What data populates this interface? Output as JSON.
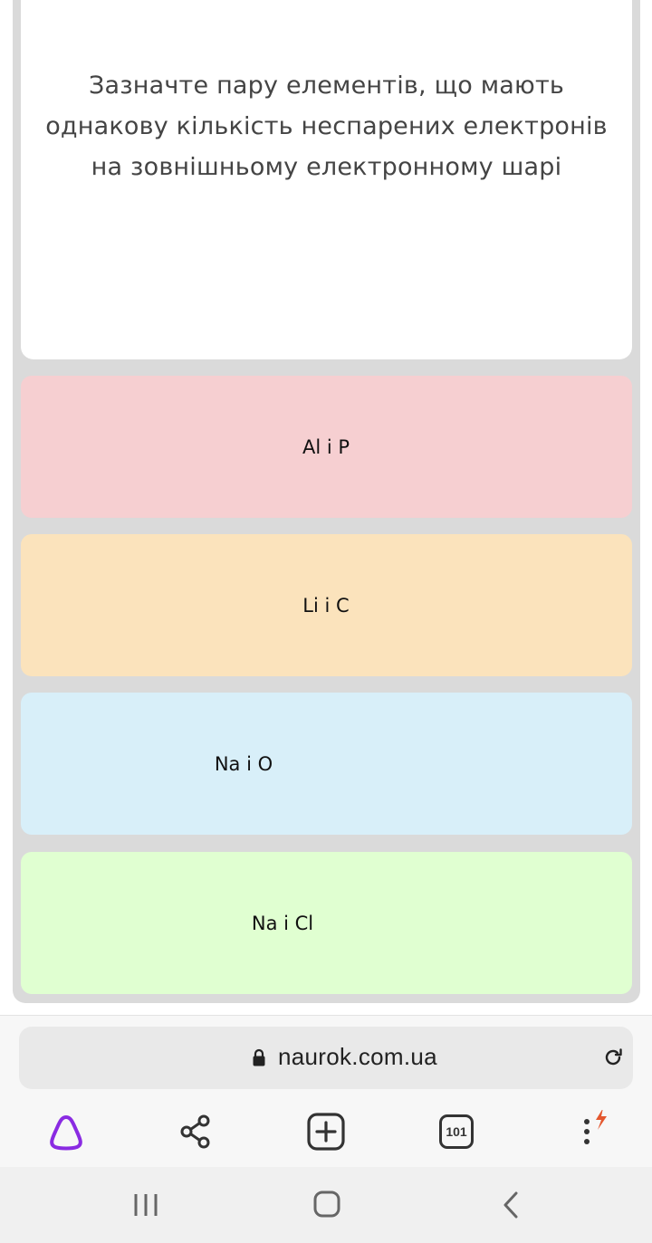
{
  "question": {
    "lines": [
      "Зазначте пару елементів, що мають",
      "однакову кількість неспарених електронів",
      "на зовнішньому електронному шарі"
    ]
  },
  "answers": [
    {
      "label": "Al і P",
      "color": "#f6cfd1"
    },
    {
      "label": "Li і C",
      "color": "#fbe3bc"
    },
    {
      "label": "Na і O",
      "color": "#d8eff9"
    },
    {
      "label": "Na і Cl",
      "color": "#e0ffd1"
    }
  ],
  "browser": {
    "url": "naurok.com.ua",
    "tabs_count": "101",
    "icons": [
      "lock-icon",
      "reload-icon",
      "alice-icon",
      "share-icon",
      "new-tab-icon",
      "tabs-icon",
      "menu-icon"
    ],
    "accent_color": "#8a2be2",
    "menu_badge_color": "#e4572e"
  },
  "system_nav": {
    "icons": [
      "recents-icon",
      "home-icon",
      "back-icon"
    ]
  }
}
